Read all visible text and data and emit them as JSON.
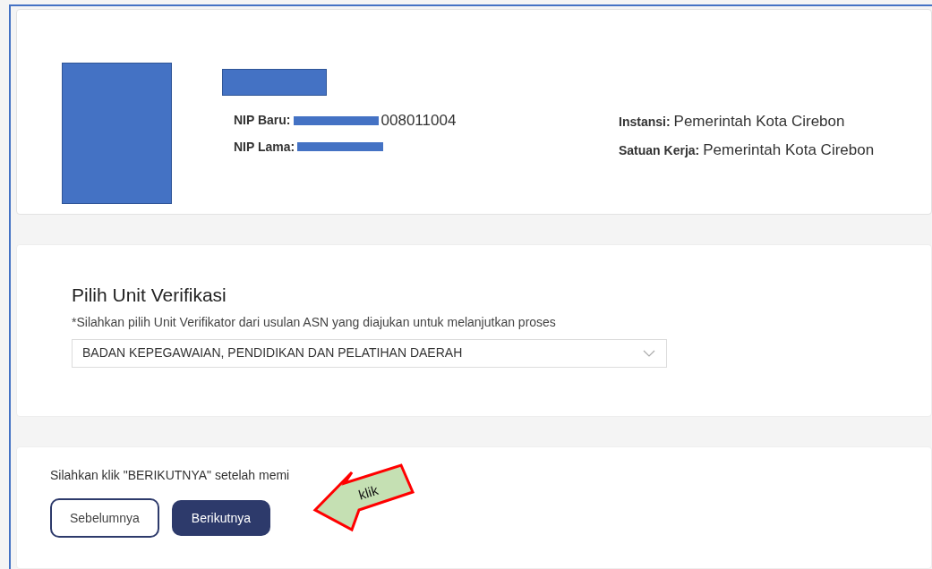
{
  "profile": {
    "nip_baru_label": "NIP Baru:",
    "nip_baru_value": "008011004",
    "nip_lama_label": "NIP Lama:",
    "instansi_label": "Instansi:",
    "instansi_value": "Pemerintah Kota Cirebon",
    "satuan_kerja_label": "Satuan Kerja:",
    "satuan_kerja_value": "Pemerintah Kota Cirebon"
  },
  "verification": {
    "title": "Pilih Unit Verifikasi",
    "hint": "*Silahkan pilih Unit Verifikator dari usulan ASN yang diajukan untuk melanjutkan proses",
    "selected_unit": "BADAN KEPEGAWAIAN, PENDIDIKAN DAN PELATIHAN DAERAH"
  },
  "footer": {
    "instruction": "Silahkan klik \"BERIKUTNYA\" setelah memi",
    "buttons": [
      {
        "label": "Sebelumnya",
        "kind": "outline"
      },
      {
        "label": "Berikutnya",
        "kind": "primary"
      }
    ],
    "callout": "klik"
  }
}
